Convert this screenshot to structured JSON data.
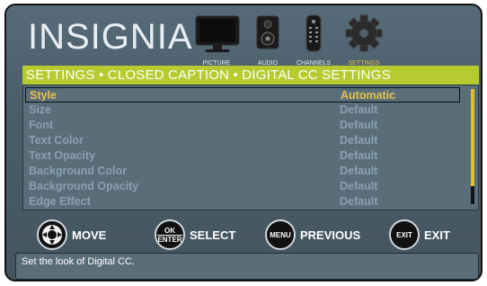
{
  "brand": "INSIGNIA",
  "tabs": [
    {
      "label": "PICTURE",
      "icon": "tv-icon",
      "selected": false
    },
    {
      "label": "AUDIO",
      "icon": "speaker-icon",
      "selected": false
    },
    {
      "label": "CHANNELS",
      "icon": "remote-icon",
      "selected": false
    },
    {
      "label": "SETTINGS",
      "icon": "gear-icon",
      "selected": true
    }
  ],
  "title": "SETTINGS • CLOSED CAPTION • DIGITAL CC SETTINGS",
  "rows": [
    {
      "name": "Style",
      "value": "Automatic",
      "selected": true
    },
    {
      "name": "Size",
      "value": "Default"
    },
    {
      "name": "Font",
      "value": "Default"
    },
    {
      "name": "Text Color",
      "value": "Default"
    },
    {
      "name": "Text Opacity",
      "value": "Default"
    },
    {
      "name": "Background Color",
      "value": "Default"
    },
    {
      "name": "Background Opacity",
      "value": "Default"
    },
    {
      "name": "Edge Effect",
      "value": "Default"
    }
  ],
  "hints": [
    {
      "label": "MOVE",
      "button": ""
    },
    {
      "label": "SELECT",
      "button_top": "OK",
      "button_bottom": "ENTER"
    },
    {
      "label": "PREVIOUS",
      "button": "MENU"
    },
    {
      "label": "EXIT",
      "button": "EXIT"
    }
  ],
  "status": "Set the look of Digital CC.",
  "colors": {
    "accent": "#b5cb2f",
    "highlight": "#e7c24a",
    "panel": "#5a6e7a"
  }
}
